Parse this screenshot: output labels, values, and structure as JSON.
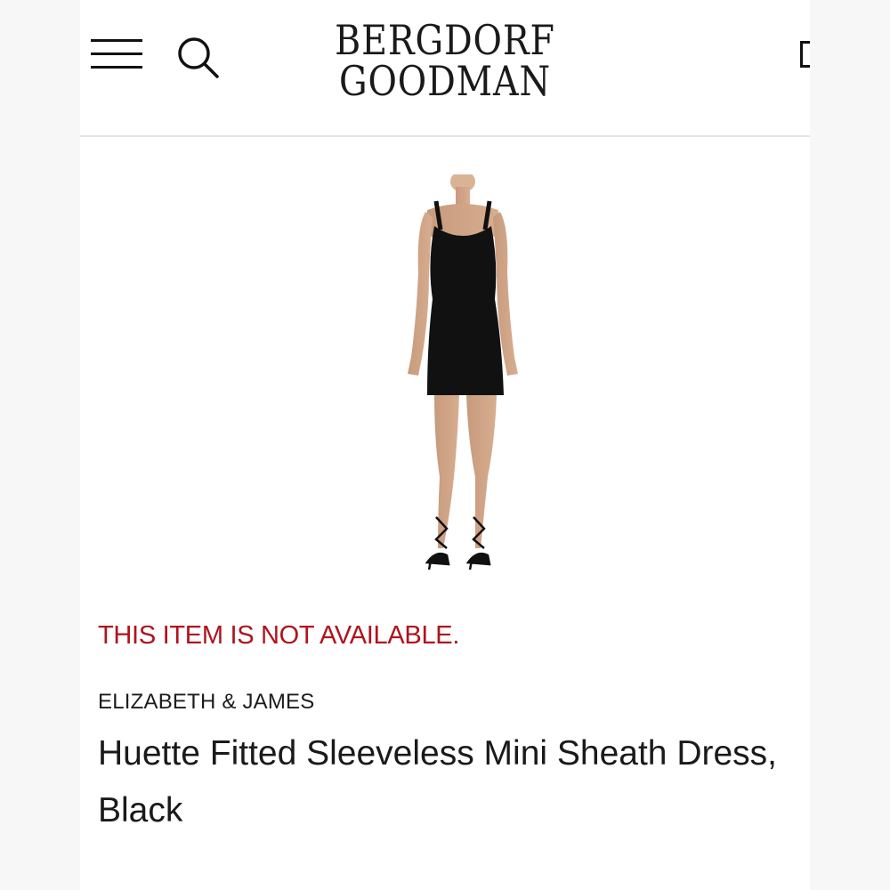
{
  "header": {
    "logo_line_1": "BERGDORF",
    "logo_line_2": "GOODMAN",
    "menu_icon": "hamburger-menu-icon",
    "search_icon": "search-icon",
    "bag_icon": "shopping-bag-icon"
  },
  "product": {
    "image_alt": "Model wearing black sleeveless mini sheath dress with black strappy sandals",
    "availability": "THIS ITEM IS NOT AVAILABLE.",
    "designer": "ELIZABETH & JAMES",
    "name": "Huette Fitted Sleeveless Mini Sheath Dress, Black"
  },
  "colors": {
    "availability_red": "#b0131c",
    "text_dark": "#1a1a1a",
    "dress_black": "#111111"
  }
}
